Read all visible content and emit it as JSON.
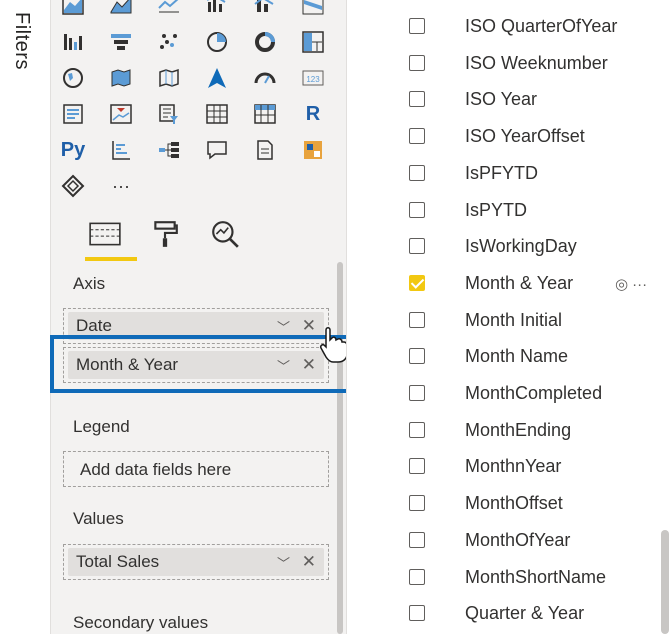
{
  "filters_pane": {
    "label": "Filters"
  },
  "visualizations": {
    "icons": [
      "stacked-area-chart-icon",
      "area-chart-icon",
      "line-chart-icon",
      "line-clustered-column-icon",
      "line-stacked-column-icon",
      "ribbon-chart-icon",
      "waterfall-chart-icon",
      "funnel-chart-icon",
      "scatter-chart-icon",
      "pie-chart-icon",
      "donut-chart-icon",
      "treemap-icon",
      "map-icon",
      "filled-map-icon",
      "shape-map-icon",
      "azure-map-icon",
      "gauge-icon",
      "card-icon",
      "multi-row-card-icon",
      "kpi-icon",
      "slicer-icon",
      "table-icon",
      "matrix-icon",
      "r-visual-icon",
      "python-visual-icon",
      "key-influencers-icon",
      "decomposition-tree-icon",
      "qa-icon",
      "smart-narrative-icon",
      "paginated-report-icon",
      "power-apps-icon",
      "more-visuals-icon"
    ],
    "r_label": "R",
    "py_label": "Py",
    "card_text": "123",
    "more_label": "···",
    "tabs": [
      "fields-tab",
      "format-tab",
      "analytics-tab"
    ],
    "axis_label": "Axis",
    "axis_fields": [
      "Date",
      "Month & Year"
    ],
    "legend_label": "Legend",
    "legend_placeholder": "Add data fields here",
    "values_label": "Values",
    "values_fields": [
      "Total Sales"
    ],
    "secondary_label": "Secondary values",
    "chevron": "﹀",
    "remove": "✕"
  },
  "fields_list": [
    {
      "name": "ISO QuarterOfYear",
      "checked": false
    },
    {
      "name": "ISO Weeknumber",
      "checked": false
    },
    {
      "name": "ISO Year",
      "checked": false
    },
    {
      "name": "ISO YearOffset",
      "checked": false
    },
    {
      "name": "IsPFYTD",
      "checked": false
    },
    {
      "name": "IsPYTD",
      "checked": false
    },
    {
      "name": "IsWorkingDay",
      "checked": false
    },
    {
      "name": "Month & Year",
      "checked": true
    },
    {
      "name": "Month Initial",
      "checked": false
    },
    {
      "name": "Month Name",
      "checked": false
    },
    {
      "name": "MonthCompleted",
      "checked": false
    },
    {
      "name": "MonthEnding",
      "checked": false
    },
    {
      "name": "MonthnYear",
      "checked": false
    },
    {
      "name": "MonthOffset",
      "checked": false
    },
    {
      "name": "MonthOfYear",
      "checked": false
    },
    {
      "name": "MonthShortName",
      "checked": false
    },
    {
      "name": "Quarter & Year",
      "checked": false
    }
  ],
  "row_actions": {
    "visibility_icon": "◎",
    "more": "···"
  },
  "colors": {
    "accent": "#f2c811",
    "highlight": "#0f6ab8",
    "pane": "#f3f2f1"
  }
}
